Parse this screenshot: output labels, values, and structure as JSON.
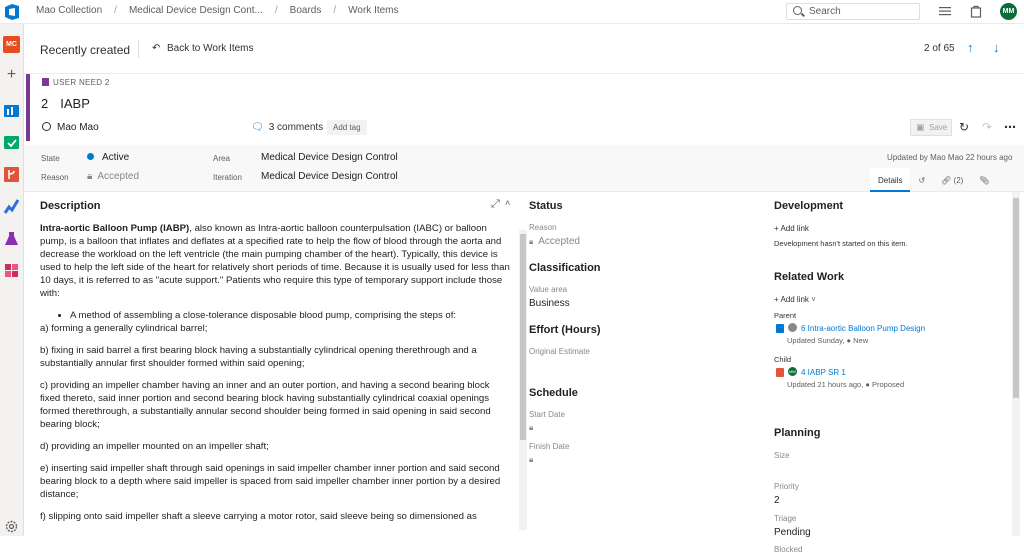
{
  "topbar": {
    "breadcrumbs": [
      "Mao Collection",
      "Medical Device Design Cont...",
      "Boards",
      "Work Items"
    ],
    "search_placeholder": "Search",
    "user_initials": "MM"
  },
  "leftnav": {
    "org_initials": "MC",
    "colors": [
      "#e74c1c",
      "#0078d4",
      "#00a86b",
      "#d9432c",
      "#2f6fd6",
      "#8a2fb2",
      "#cc2d5e"
    ]
  },
  "header": {
    "recently_created": "Recently created",
    "back_label": "Back to Work Items",
    "pager": "2 of 65"
  },
  "work_item": {
    "type": "USER NEED 2",
    "id": "2",
    "title": "IABP",
    "assigned_to": "Mao Mao",
    "comments": "3 comments",
    "add_tag": "Add tag",
    "save": "Save",
    "updated_by": "Updated by Mao Mao 22 hours ago"
  },
  "fields": {
    "state_label": "State",
    "state_value": "Active",
    "reason_label": "Reason",
    "reason_value": "Accepted",
    "area_label": "Area",
    "area_value": "Medical Device Design Control",
    "iteration_label": "Iteration",
    "iteration_value": "Medical Device Design Control"
  },
  "tabs": [
    "Details",
    "",
    "(2)",
    ""
  ],
  "description": {
    "heading": "Description",
    "intro_bold": "Intra-aortic Balloon Pump (IABP)",
    "intro_rest": ", also known as Intra-aortic balloon counterpulsation (IABC) or balloon pump, is a balloon that inflates and deflates at a specified rate to help the flow of blood through the aorta and decrease the workload on the left ventricle (the main pumping chamber of the heart). Typically, this device is used to help the left side of the heart for relatively short periods of time. Because it is usually used for less than 10 days, it is referred to as \"acute support.\" Patients who require this type of temporary support include those with:",
    "bullet": "A method of assembling a close-tolerance disposable blood pump, comprising the steps of:",
    "steps": [
      "a) forming a generally cylindrical barrel;",
      "b) fixing in said barrel a first bearing block having a substantially cylindrical opening therethrough and a substantially annular first shoulder formed within said opening;",
      "c) providing an impeller chamber having an inner and an outer portion, and having a second bearing block fixed thereto, said inner portion and second bearing block having substantially cylindrical coaxial openings formed therethrough, a substantially annular second shoulder being formed in said opening in said second bearing block;",
      "d) providing an impeller mounted on an impeller shaft;",
      "e) inserting said impeller shaft through said openings in said impeller chamber inner portion and said second bearing block to a depth where said impeller is spaced from said impeller chamber inner portion by a desired distance;",
      "f) slipping onto said impeller shaft a sleeve carrying a motor rotor, said sleeve being so dimensioned as"
    ]
  },
  "status": {
    "heading": "Status",
    "reason_label": "Reason",
    "reason_value": "Accepted",
    "classification_heading": "Classification",
    "value_area_label": "Value area",
    "value_area_value": "Business",
    "effort_heading": "Effort (Hours)",
    "original_estimate_label": "Original Estimate",
    "schedule_heading": "Schedule",
    "start_date_label": "Start Date",
    "finish_date_label": "Finish Date"
  },
  "development": {
    "heading": "Development",
    "add_link": "+ Add link",
    "note": "Development hasn't started on this item."
  },
  "related": {
    "heading": "Related Work",
    "add_link": "+ Add link",
    "parent_label": "Parent",
    "parent_title": "6 Intra-aortic Balloon Pump Design",
    "parent_sub": "Updated Sunday,",
    "parent_state": "New",
    "child_label": "Child",
    "child_title": "4 IABP SR 1",
    "child_avatar": "MM",
    "child_sub": "Updated 21 hours ago,",
    "child_state": "Proposed"
  },
  "planning": {
    "heading": "Planning",
    "size_label": "Size",
    "priority_label": "Priority",
    "priority_value": "2",
    "triage_label": "Triage",
    "triage_value": "Pending",
    "blocked_label": "Blocked"
  }
}
